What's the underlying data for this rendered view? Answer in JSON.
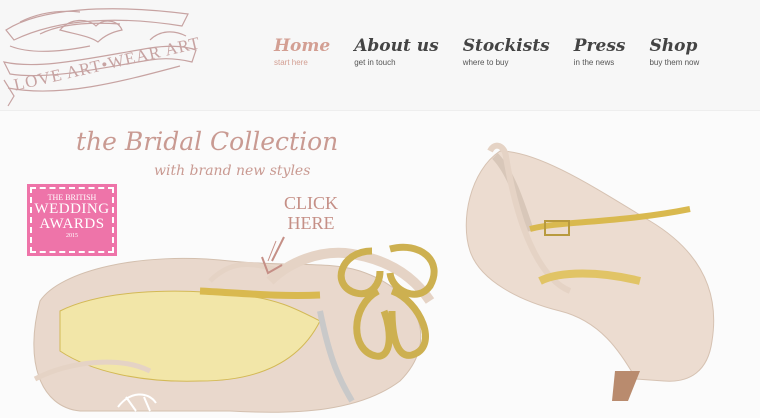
{
  "brand": {
    "logo_text": "LOVE ART•WEAR ART"
  },
  "nav": {
    "items": [
      {
        "label": "Home",
        "sub": "start here"
      },
      {
        "label": "About us",
        "sub": "get in touch"
      },
      {
        "label": "Stockists",
        "sub": "where to buy"
      },
      {
        "label": "Press",
        "sub": "in the news"
      },
      {
        "label": "Shop",
        "sub": "buy them now"
      }
    ]
  },
  "hero": {
    "title": "the Bridal Collection",
    "subtitle": "with brand new styles",
    "cta_line1": "CLICK",
    "cta_line2": "HERE"
  },
  "award": {
    "line1": "THE BRITISH",
    "line2": "WEDDING",
    "line3": "AWARDS",
    "year": "2015"
  },
  "colors": {
    "accent": "#d39f93",
    "award_pink": "#ee74a9",
    "nav_text": "#444444"
  },
  "icons": {
    "logo": "swallow-banner-icon",
    "cta_arrow": "arrow-down-icon"
  }
}
